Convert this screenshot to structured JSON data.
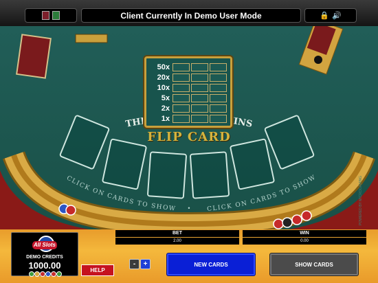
{
  "header": {
    "status_message": "Client Currently In Demo User Mode"
  },
  "paytable": {
    "rows": [
      "50x",
      "20x",
      "10x",
      "5x",
      "2x",
      "1x"
    ]
  },
  "game": {
    "title": "FLIP CARD",
    "arc_text": "THREE OF A KIND WINS",
    "left_prompt": "CLICK ON CARDS TO SHOW",
    "right_prompt": "CLICK ON CARDS TO SHOW",
    "separator": "•",
    "powered_by": "POWERED BY MICROGAMING"
  },
  "panel": {
    "logo_text": "All Slots",
    "demo_credits_label": "DEMO CREDITS",
    "demo_credits_value": "1000.00",
    "help_label": "HELP",
    "bet_label": "BET",
    "bet_value": "2.00",
    "win_label": "WIN",
    "win_value": "0.00",
    "minus_label": "-",
    "plus_label": "+",
    "new_cards_label": "NEW CARDS",
    "show_cards_label": "SHOW CARDS"
  },
  "colors": {
    "felt": "#1f5b54",
    "gold": "#d4b33e",
    "new_cards": "#0a1fd6",
    "show_cards": "#4b4b4b",
    "help": "#c5121f"
  },
  "icons": {
    "top_left": [
      "card-icon",
      "card-icon-green"
    ],
    "top_right": [
      "lock-icon",
      "sound-icon"
    ]
  }
}
